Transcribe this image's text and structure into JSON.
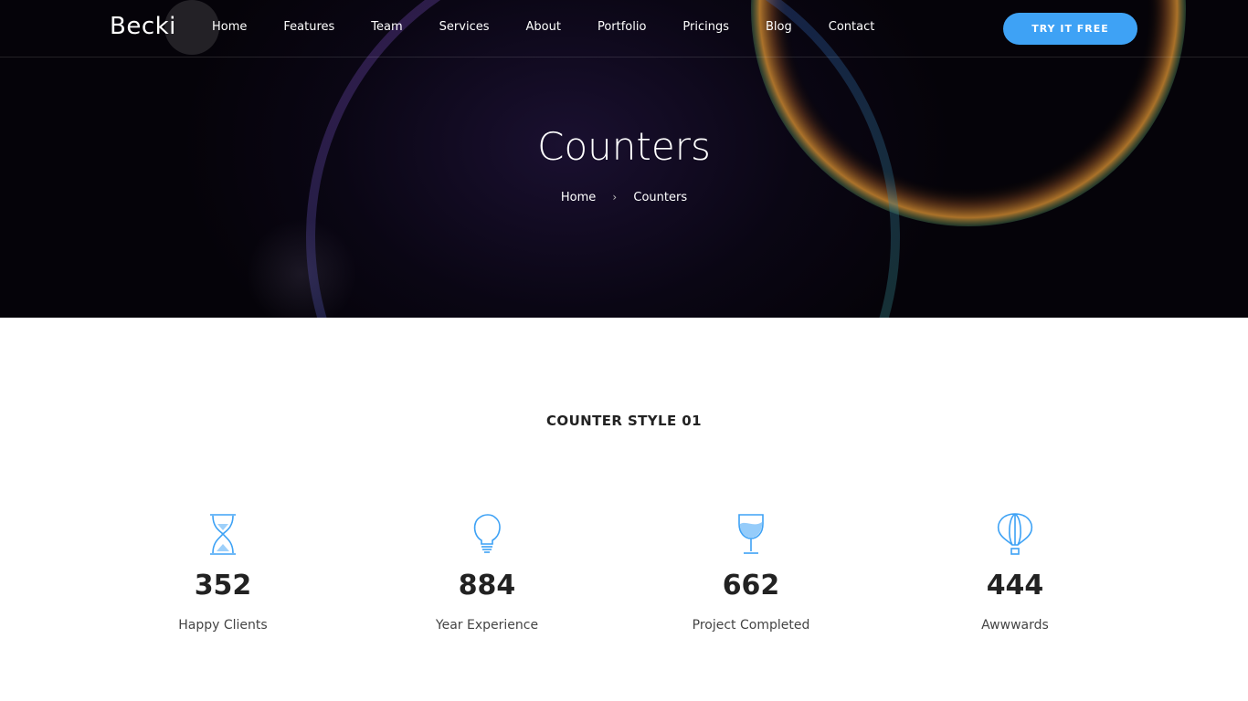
{
  "brand": {
    "logo": "Becki",
    "accent": "#3ea2f5"
  },
  "nav": {
    "items": [
      "Home",
      "Features",
      "Team",
      "Services",
      "About",
      "Portfolio",
      "Pricings",
      "Blog",
      "Contact"
    ],
    "cta_label": "TRY IT FREE"
  },
  "hero": {
    "title": "Counters",
    "breadcrumb": {
      "home": "Home",
      "current": "Counters",
      "separator": "›"
    }
  },
  "section": {
    "title": "COUNTER STYLE 01"
  },
  "counters": [
    {
      "icon": "hourglass-icon",
      "value": "352",
      "label": "Happy Clients"
    },
    {
      "icon": "lightbulb-icon",
      "value": "884",
      "label": "Year Experience"
    },
    {
      "icon": "wine-glass-icon",
      "value": "662",
      "label": "Project Completed"
    },
    {
      "icon": "hot-air-balloon-icon",
      "value": "444",
      "label": "Awwwards"
    }
  ]
}
